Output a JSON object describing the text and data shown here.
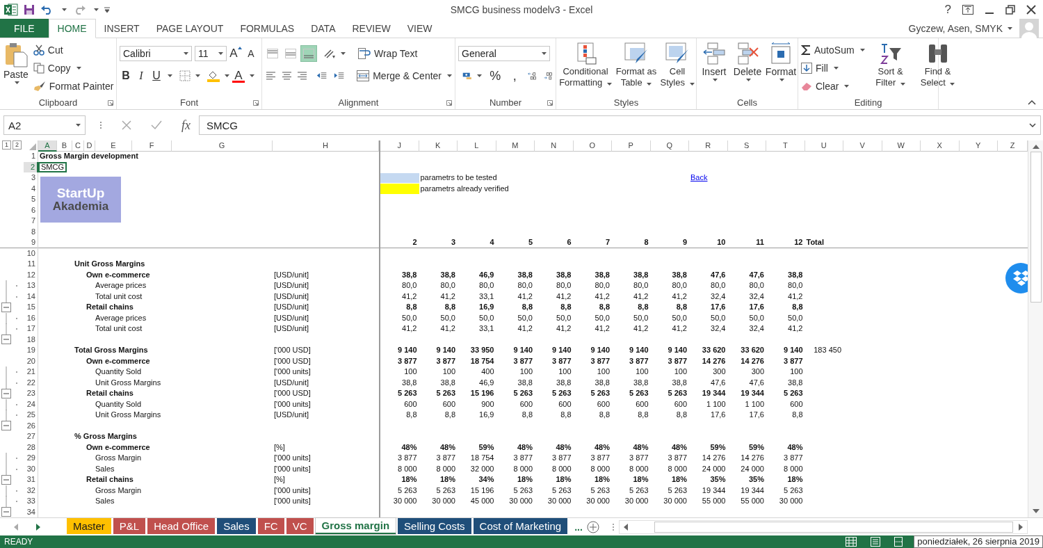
{
  "window": {
    "title": "SMCG business modelv3 - Excel",
    "help": "?"
  },
  "ribbon_tabs": [
    {
      "label": "FILE",
      "kind": "file",
      "selected": false
    },
    {
      "label": "HOME",
      "kind": "tab",
      "selected": true
    },
    {
      "label": "INSERT",
      "kind": "tab",
      "selected": false
    },
    {
      "label": "PAGE LAYOUT",
      "kind": "tab",
      "selected": false
    },
    {
      "label": "FORMULAS",
      "kind": "tab",
      "selected": false
    },
    {
      "label": "DATA",
      "kind": "tab",
      "selected": false
    },
    {
      "label": "REVIEW",
      "kind": "tab",
      "selected": false
    },
    {
      "label": "VIEW",
      "kind": "tab",
      "selected": false
    }
  ],
  "user": {
    "name": "Gyczew, Asen, SMYK"
  },
  "clipboard": {
    "label": "Clipboard",
    "paste": "Paste",
    "cut": "Cut",
    "copy": "Copy",
    "format_painter": "Format Painter"
  },
  "font": {
    "label": "Font",
    "name": "Calibri",
    "size": "11",
    "grow": "A",
    "shrink": "A",
    "bold": "B",
    "italic": "I",
    "underline": "U",
    "color_letter": "A"
  },
  "alignment": {
    "label": "Alignment",
    "wrap_text": "Wrap Text",
    "merge_center": "Merge & Center",
    "vertical": [
      {
        "kind": "top",
        "selected": false
      },
      {
        "kind": "middle",
        "selected": false
      },
      {
        "kind": "bottom",
        "selected": true
      }
    ],
    "horizontal": [
      {
        "kind": "left",
        "selected": false
      },
      {
        "kind": "center",
        "selected": false
      },
      {
        "kind": "right",
        "selected": false
      }
    ]
  },
  "number": {
    "label": "Number",
    "format": "General",
    "percent": "%",
    "comma": ","
  },
  "styles": {
    "label": "Styles",
    "buttons": [
      {
        "kind": "conditional",
        "label": "Conditional Formatting"
      },
      {
        "kind": "table",
        "label": "Format as Table"
      },
      {
        "kind": "cell",
        "label": "Cell Styles"
      }
    ]
  },
  "cells": {
    "label": "Cells",
    "buttons": [
      {
        "kind": "insert",
        "label": "Insert"
      },
      {
        "kind": "delete",
        "label": "Delete"
      },
      {
        "kind": "format",
        "label": "Format"
      }
    ]
  },
  "editing": {
    "label": "Editing",
    "autosum": "AutoSum",
    "fill": "Fill",
    "clear": "Clear",
    "sort_filter": "Sort & Filter",
    "find_select": "Find & Select"
  },
  "formula_bar": {
    "name_box": "A2",
    "fx": "fx",
    "value": "SMCG"
  },
  "outline_levels": [
    "1",
    "2"
  ],
  "columns": [
    {
      "letter": "A",
      "selected": true
    },
    {
      "letter": "B",
      "selected": false
    },
    {
      "letter": "C",
      "selected": false
    },
    {
      "letter": "D",
      "selected": false
    },
    {
      "letter": "E",
      "selected": false
    },
    {
      "letter": "F",
      "selected": false
    },
    {
      "letter": "G",
      "selected": false
    },
    {
      "letter": "H",
      "selected": false
    },
    {
      "letter": "J",
      "selected": false
    },
    {
      "letter": "K",
      "selected": false
    },
    {
      "letter": "L",
      "selected": false
    },
    {
      "letter": "M",
      "selected": false
    },
    {
      "letter": "N",
      "selected": false
    },
    {
      "letter": "O",
      "selected": false
    },
    {
      "letter": "P",
      "selected": false
    },
    {
      "letter": "Q",
      "selected": false
    },
    {
      "letter": "R",
      "selected": false
    },
    {
      "letter": "S",
      "selected": false
    },
    {
      "letter": "T",
      "selected": false
    },
    {
      "letter": "U",
      "selected": false
    },
    {
      "letter": "V",
      "selected": false
    },
    {
      "letter": "W",
      "selected": false
    },
    {
      "letter": "X",
      "selected": false
    },
    {
      "letter": "Y",
      "selected": false
    },
    {
      "letter": "Z",
      "selected": false
    }
  ],
  "logo": {
    "line_1": "StartUp",
    "line_2": "Akademia"
  },
  "rows": [
    {
      "row": "1",
      "selected": false,
      "kind": "title",
      "label": "Gross Margin development"
    },
    {
      "row": "2",
      "selected": true,
      "kind": "plain",
      "label": "SMCG"
    },
    {
      "row": "3",
      "selected": false,
      "legend": {
        "color": "#c5d9f1",
        "text": "parametrs to be tested"
      },
      "link": "Back"
    },
    {
      "row": "4",
      "selected": false,
      "legend": {
        "color": "#ffff00",
        "text": "parametrs already verified"
      }
    },
    {
      "row": "5",
      "selected": false
    },
    {
      "row": "6",
      "selected": false
    },
    {
      "row": "7",
      "selected": false
    },
    {
      "row": "8",
      "selected": false
    },
    {
      "row": "9",
      "selected": false,
      "kind": "header",
      "values": [
        "2",
        "3",
        "4",
        "5",
        "6",
        "7",
        "8",
        "9",
        "10",
        "11",
        "12"
      ],
      "total": "Total"
    },
    {
      "row": "10",
      "selected": false
    },
    {
      "row": "11",
      "selected": false,
      "kind": "section",
      "label": "Unit Gross Margins"
    },
    {
      "row": "12",
      "selected": false,
      "kind": "group",
      "label": "Own e-commerce",
      "unit": "[USD/unit]",
      "values": [
        "38,8",
        "38,8",
        "46,9",
        "38,8",
        "38,8",
        "38,8",
        "38,8",
        "38,8",
        "47,6",
        "47,6",
        "38,8"
      ]
    },
    {
      "row": "13",
      "selected": false,
      "kind": "detail",
      "outline": {
        "kind": "dot"
      },
      "label": "Average prices",
      "unit": "[USD/unit]",
      "values": [
        "80,0",
        "80,0",
        "80,0",
        "80,0",
        "80,0",
        "80,0",
        "80,0",
        "80,0",
        "80,0",
        "80,0",
        "80,0"
      ]
    },
    {
      "row": "14",
      "selected": false,
      "kind": "detail",
      "outline": {
        "kind": "dot"
      },
      "label": "Total unit cost",
      "unit": "[USD/unit]",
      "values": [
        "41,2",
        "41,2",
        "33,1",
        "41,2",
        "41,2",
        "41,2",
        "41,2",
        "41,2",
        "32,4",
        "32,4",
        "41,2"
      ]
    },
    {
      "row": "15",
      "selected": false,
      "kind": "group",
      "outline": {
        "kind": "button"
      },
      "label": "Retail chains",
      "unit": "[USD/unit]",
      "values": [
        "8,8",
        "8,8",
        "16,9",
        "8,8",
        "8,8",
        "8,8",
        "8,8",
        "8,8",
        "17,6",
        "17,6",
        "8,8"
      ]
    },
    {
      "row": "16",
      "selected": false,
      "kind": "detail",
      "outline": {
        "kind": "dot"
      },
      "label": "Average prices",
      "unit": "[USD/unit]",
      "values": [
        "50,0",
        "50,0",
        "50,0",
        "50,0",
        "50,0",
        "50,0",
        "50,0",
        "50,0",
        "50,0",
        "50,0",
        "50,0"
      ]
    },
    {
      "row": "17",
      "selected": false,
      "kind": "detail",
      "outline": {
        "kind": "dot"
      },
      "label": "Total unit cost",
      "unit": "[USD/unit]",
      "values": [
        "41,2",
        "41,2",
        "33,1",
        "41,2",
        "41,2",
        "41,2",
        "41,2",
        "41,2",
        "32,4",
        "32,4",
        "41,2"
      ]
    },
    {
      "row": "18",
      "selected": false,
      "outline": {
        "kind": "button"
      }
    },
    {
      "row": "19",
      "selected": false,
      "kind": "section",
      "label": "Total Gross Margins",
      "unit": "['000 USD]",
      "values": [
        "9 140",
        "9 140",
        "33 950",
        "9 140",
        "9 140",
        "9 140",
        "9 140",
        "9 140",
        "33 620",
        "33 620",
        "9 140"
      ],
      "total": "183 450"
    },
    {
      "row": "20",
      "selected": false,
      "kind": "group",
      "label": "Own e-commerce",
      "unit": "['000 USD]",
      "values": [
        "3 877",
        "3 877",
        "18 754",
        "3 877",
        "3 877",
        "3 877",
        "3 877",
        "3 877",
        "14 276",
        "14 276",
        "3 877"
      ]
    },
    {
      "row": "21",
      "selected": false,
      "kind": "detail",
      "outline": {
        "kind": "dot"
      },
      "label": "Quantity Sold",
      "unit": "['000 units]",
      "values": [
        "100",
        "100",
        "400",
        "100",
        "100",
        "100",
        "100",
        "100",
        "300",
        "300",
        "100"
      ]
    },
    {
      "row": "22",
      "selected": false,
      "kind": "detail",
      "outline": {
        "kind": "dot"
      },
      "label": "Unit Gross Margins",
      "unit": "[USD/unit]",
      "values": [
        "38,8",
        "38,8",
        "46,9",
        "38,8",
        "38,8",
        "38,8",
        "38,8",
        "38,8",
        "47,6",
        "47,6",
        "38,8"
      ]
    },
    {
      "row": "23",
      "selected": false,
      "kind": "group",
      "outline": {
        "kind": "button"
      },
      "label": "Retail chains",
      "unit": "['000 USD]",
      "values": [
        "5 263",
        "5 263",
        "15 196",
        "5 263",
        "5 263",
        "5 263",
        "5 263",
        "5 263",
        "19 344",
        "19 344",
        "5 263"
      ]
    },
    {
      "row": "24",
      "selected": false,
      "kind": "detail",
      "outline": {
        "kind": "dot"
      },
      "label": "Quantity Sold",
      "unit": "['000 units]",
      "values": [
        "600",
        "600",
        "900",
        "600",
        "600",
        "600",
        "600",
        "600",
        "1 100",
        "1 100",
        "600"
      ]
    },
    {
      "row": "25",
      "selected": false,
      "kind": "detail",
      "outline": {
        "kind": "dot"
      },
      "label": "Unit Gross Margins",
      "unit": "[USD/unit]",
      "values": [
        "8,8",
        "8,8",
        "16,9",
        "8,8",
        "8,8",
        "8,8",
        "8,8",
        "8,8",
        "17,6",
        "17,6",
        "8,8"
      ]
    },
    {
      "row": "26",
      "selected": false,
      "outline": {
        "kind": "button"
      }
    },
    {
      "row": "27",
      "selected": false,
      "kind": "section",
      "label": "% Gross Margins"
    },
    {
      "row": "28",
      "selected": false,
      "kind": "group",
      "label": "Own e-commerce",
      "unit": "[%]",
      "values": [
        "48%",
        "48%",
        "59%",
        "48%",
        "48%",
        "48%",
        "48%",
        "48%",
        "59%",
        "59%",
        "48%"
      ]
    },
    {
      "row": "29",
      "selected": false,
      "kind": "detail",
      "outline": {
        "kind": "dot"
      },
      "label": "Gross Margin",
      "unit": "['000 units]",
      "values": [
        "3 877",
        "3 877",
        "18 754",
        "3 877",
        "3 877",
        "3 877",
        "3 877",
        "3 877",
        "14 276",
        "14 276",
        "3 877"
      ]
    },
    {
      "row": "30",
      "selected": false,
      "kind": "detail",
      "outline": {
        "kind": "dot"
      },
      "label": "Sales",
      "unit": "['000 units]",
      "values": [
        "8 000",
        "8 000",
        "32 000",
        "8 000",
        "8 000",
        "8 000",
        "8 000",
        "8 000",
        "24 000",
        "24 000",
        "8 000"
      ]
    },
    {
      "row": "31",
      "selected": false,
      "kind": "group",
      "outline": {
        "kind": "button"
      },
      "label": "Retail chains",
      "unit": "[%]",
      "values": [
        "18%",
        "18%",
        "34%",
        "18%",
        "18%",
        "18%",
        "18%",
        "18%",
        "35%",
        "35%",
        "18%"
      ]
    },
    {
      "row": "32",
      "selected": false,
      "kind": "detail",
      "outline": {
        "kind": "dot"
      },
      "label": "Gross Margin",
      "unit": "['000 units]",
      "values": [
        "5 263",
        "5 263",
        "15 196",
        "5 263",
        "5 263",
        "5 263",
        "5 263",
        "5 263",
        "19 344",
        "19 344",
        "5 263"
      ]
    },
    {
      "row": "33",
      "selected": false,
      "kind": "detail",
      "outline": {
        "kind": "dot"
      },
      "label": "Sales",
      "unit": "['000 units]",
      "values": [
        "30 000",
        "30 000",
        "45 000",
        "30 000",
        "30 000",
        "30 000",
        "30 000",
        "30 000",
        "55 000",
        "55 000",
        "30 000"
      ]
    },
    {
      "row": "34",
      "selected": false,
      "outline": {
        "kind": "button"
      }
    }
  ],
  "sheet_tabs": [
    {
      "label": "Master",
      "color": "#ffc000",
      "selected": false
    },
    {
      "label": "P&L",
      "color": "#c0504d",
      "selected": false
    },
    {
      "label": "Head Office",
      "color": "#c0504d",
      "selected": false
    },
    {
      "label": "Sales",
      "color": "#1f4e79",
      "selected": false
    },
    {
      "label": "FC",
      "color": "#c0504d",
      "selected": false
    },
    {
      "label": "VC",
      "color": "#c0504d",
      "selected": false
    },
    {
      "label": "Gross margin",
      "color": "#217346",
      "selected": true
    },
    {
      "label": "Selling Costs",
      "color": "#1f4e79",
      "selected": false
    },
    {
      "label": "Cost of Marketing",
      "color": "#1f4e79",
      "selected": false
    }
  ],
  "more_tabs": "...",
  "status": {
    "mode": "READY",
    "date_tip": "poniedziałek, 26 sierpnia 2019"
  }
}
